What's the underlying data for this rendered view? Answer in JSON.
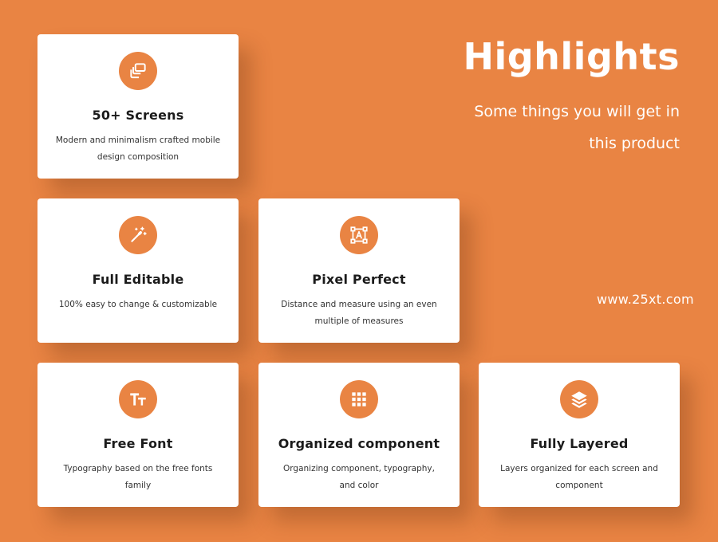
{
  "hero": {
    "title": "Highlights",
    "subtitle": "Some things you will get in this product"
  },
  "watermark": "www.25xt.com",
  "cards": [
    {
      "icon": "screens-icon",
      "title": "50+ Screens",
      "desc": "Modern and minimalism crafted mobile design composition"
    },
    {
      "icon": "magic-wand-icon",
      "title": "Full Editable",
      "desc": "100% easy to change & customizable"
    },
    {
      "icon": "pixel-frame-icon",
      "title": "Pixel Perfect",
      "desc": "Distance and measure using an even multiple of measures"
    },
    {
      "icon": "font-icon",
      "title": "Free Font",
      "desc": "Typography based on the free fonts family"
    },
    {
      "icon": "grid-icon",
      "title": "Organized component",
      "desc": "Organizing component, typography, and color"
    },
    {
      "icon": "layers-icon",
      "title": "Fully Layered",
      "desc": "Layers organized for each screen and component"
    }
  ],
  "colors": {
    "accent": "#E98443",
    "card": "#FFFFFF",
    "text": "#1B1B1B"
  }
}
